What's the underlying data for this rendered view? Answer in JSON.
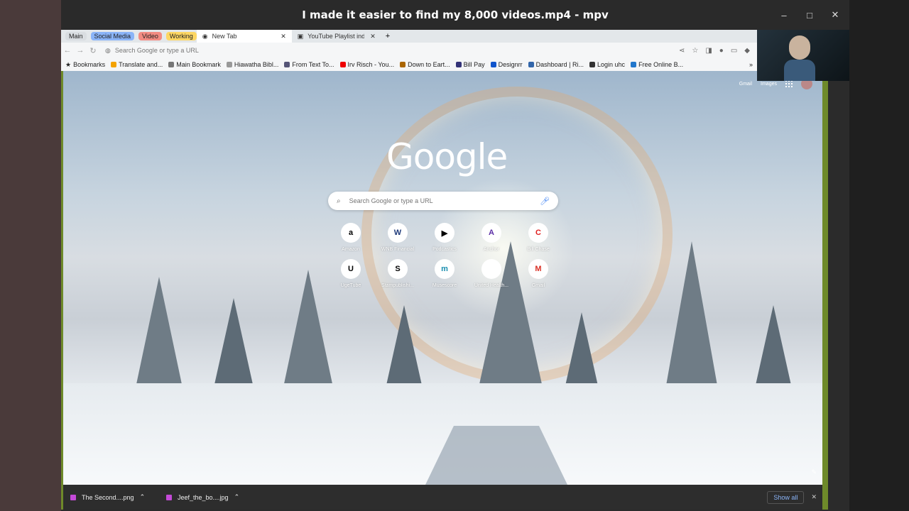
{
  "window": {
    "title": "I made it easier to find my 8,000 videos.mp4 - mpv"
  },
  "tab_groups": [
    {
      "label": "Main",
      "color": "#d9dde1"
    },
    {
      "label": "Social Media",
      "color": "#8ab4f8"
    },
    {
      "label": "Video",
      "color": "#f28b82"
    },
    {
      "label": "Working",
      "color": "#fdd663"
    }
  ],
  "tabs": [
    {
      "label": "New Tab",
      "active": true
    },
    {
      "label": "YouTube Playlist index pa",
      "active": false
    }
  ],
  "address": {
    "placeholder": "Search Google or type a URL"
  },
  "bookmarks": [
    {
      "label": "Bookmarks",
      "icon": "star-icon"
    },
    {
      "label": "Translate and...",
      "icon": "translate-icon"
    },
    {
      "label": "Main Bookmark",
      "icon": "folder-icon"
    },
    {
      "label": "Hiawatha Bibl...",
      "icon": "bible-icon"
    },
    {
      "label": "From Text To...",
      "icon": "text-icon"
    },
    {
      "label": "Irv Risch - You...",
      "icon": "youtube-icon"
    },
    {
      "label": "Down to Eart...",
      "icon": "earth-icon"
    },
    {
      "label": "Bill Pay",
      "icon": "billpay-icon"
    },
    {
      "label": "Designrr",
      "icon": "designrr-icon"
    },
    {
      "label": "Dashboard | Ri...",
      "icon": "dashboard-icon"
    },
    {
      "label": "Login uhc",
      "icon": "login-icon"
    },
    {
      "label": "Free Online B...",
      "icon": "online-icon"
    }
  ],
  "ntp": {
    "links": {
      "gmail": "Gmail",
      "images": "Images"
    },
    "logo": "Google",
    "search_placeholder": "Search Google or type a URL",
    "shortcuts": [
      {
        "label": "Amazon",
        "glyph": "a"
      },
      {
        "label": "WNB Financial",
        "glyph": "W"
      },
      {
        "label": "Podcastics",
        "glyph": "▶"
      },
      {
        "label": "Anchor",
        "glyph": "A"
      },
      {
        "label": "Bill Chase",
        "glyph": "C"
      },
      {
        "label": "UgeTube",
        "glyph": "U"
      },
      {
        "label": "Stampublishi...",
        "glyph": "S"
      },
      {
        "label": "Musescore",
        "glyph": "m"
      },
      {
        "label": "United Health...",
        "glyph": ""
      },
      {
        "label": "Gmail",
        "glyph": "M"
      }
    ]
  },
  "downloads": [
    {
      "label": "The Second....png"
    },
    {
      "label": "Jeef_the_bo....jpg"
    }
  ],
  "download_bar": {
    "show_all": "Show all"
  }
}
